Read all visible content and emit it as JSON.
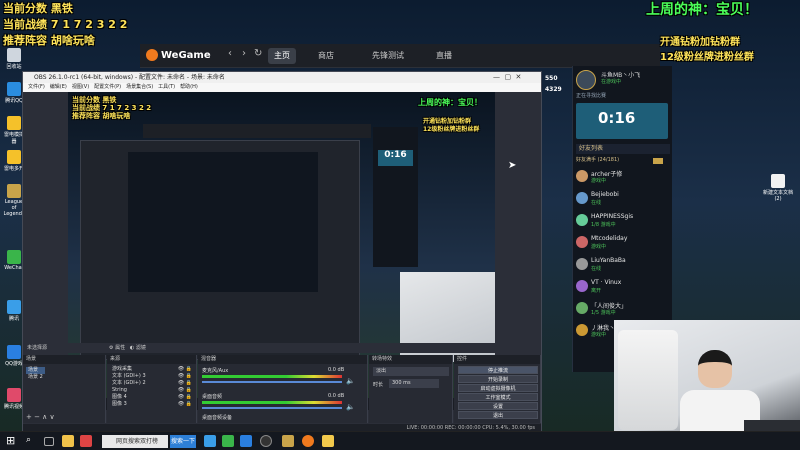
{
  "overlay": {
    "rank": "当前分数 黑铁",
    "record": "当前战绩 7 1 7 2 3 2 2",
    "recommend": "推荐阵容 胡啥玩啥",
    "god": "上周的神：宝贝！",
    "fan1": "开通钻粉加钻粉群",
    "fan2": "12级粉丝牌进粉丝群"
  },
  "wegame": {
    "logo": "WeGame",
    "nav": [
      "主页",
      "商店",
      "先锋测试",
      "直播"
    ]
  },
  "rightpanel": {
    "name": "斗鱼MB丶小飞",
    "sub": "在游戏中",
    "num1": "550",
    "num2": "4329",
    "timer_label": "正在寻找比赛",
    "timer": "0:16",
    "friends_title": "好友列表",
    "friends_group": "好友满手",
    "friends_count": "(24/181)",
    "friends": [
      {
        "name": "archer子修",
        "status": "游戏中",
        "color": "#c96"
      },
      {
        "name": "Bejiebobi",
        "status": "在线",
        "color": "#69c"
      },
      {
        "name": "HAPPINESSgis",
        "status": "1/8 游戏中",
        "color": "#6c9"
      },
      {
        "name": "Mtcodeliday",
        "status": "游戏中",
        "color": "#c66"
      },
      {
        "name": "LiuYanBaBa",
        "status": "在线",
        "color": "#999"
      },
      {
        "name": "VT · Vinux",
        "status": "离开",
        "color": "#96c"
      },
      {
        "name": "「人间俊大」",
        "status": "1/5 游戏中",
        "color": "#6a6"
      },
      {
        "name": "丿淋我丶",
        "status": "游戏中",
        "color": "#c93"
      }
    ]
  },
  "desktop": {
    "icons": [
      "回收站",
      "腾讯QQ",
      "雷电模拟器",
      "雷电多开",
      "League of Legends",
      "WeChat",
      "腾讯",
      "QQ游戏",
      "腾讯视频"
    ],
    "right_icon": "新建文本文档 (2)"
  },
  "obs": {
    "title": "OBS 26.1.0-rc1 (64-bit, windows) - 配置文件: 未命名 - 场景: 未命名",
    "menu": [
      "文件(F)",
      "编辑(E)",
      "视图(V)",
      "配置文件(P)",
      "场景集合(S)",
      "工具(T)",
      "帮助(H)"
    ],
    "scene_header": "场景",
    "scenes": [
      "场景",
      "场景 2"
    ],
    "source_header": "来源",
    "sources": [
      "游戏采集",
      "文本 (GDI+) 3",
      "文本 (GDI+) 2",
      "String",
      "图像 4",
      "图像 3"
    ],
    "audio_header": "混音器",
    "audio": [
      {
        "name": "麦克风/Aux",
        "level": "0.0 dB"
      },
      {
        "name": "桌面音频",
        "level": "0.0 dB"
      }
    ],
    "audio2": "桌面音频设备",
    "trans_header": "转场特效",
    "trans_type": "淡出",
    "duration_label": "时长",
    "duration": "300 ms",
    "ctrl_header": "控件",
    "buttons": [
      "停止推流",
      "开始录制",
      "启动虚拟摄像机",
      "工作室模式",
      "设置",
      "退出"
    ],
    "status": "LIVE: 00:00:00   REC: 00:00:00   CPU: 5.4%, 30.00 fps",
    "mode_label": "未选择源",
    "prop": "属性",
    "filter": "滤镜"
  },
  "taskbar": {
    "search": "网页搜索双打榜",
    "follow": "搜索一下"
  }
}
